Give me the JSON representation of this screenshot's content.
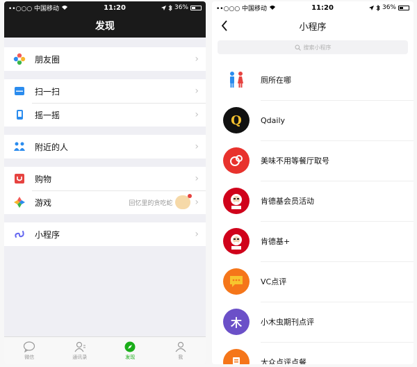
{
  "left": {
    "status": {
      "carrier": "••○○○ 中国移动",
      "time": "11:20",
      "battery": "36%"
    },
    "title": "发现",
    "groups": [
      [
        {
          "label": "朋友圈",
          "icon": "moments-icon"
        }
      ],
      [
        {
          "label": "扫一扫",
          "icon": "scan-icon"
        },
        {
          "label": "摇一摇",
          "icon": "shake-icon"
        }
      ],
      [
        {
          "label": "附近的人",
          "icon": "people-nearby-icon"
        }
      ],
      [
        {
          "label": "购物",
          "icon": "shopping-icon"
        },
        {
          "label": "游戏",
          "icon": "games-icon",
          "extra": "回忆里的贪吃蛇"
        }
      ],
      [
        {
          "label": "小程序",
          "icon": "mini-program-icon"
        }
      ]
    ],
    "tabs": [
      {
        "label": "微信",
        "icon": "chats-icon",
        "active": false
      },
      {
        "label": "通讯录",
        "icon": "contacts-icon",
        "active": false
      },
      {
        "label": "发现",
        "icon": "discover-icon",
        "active": true
      },
      {
        "label": "我",
        "icon": "me-icon",
        "active": false
      }
    ],
    "colors": {
      "nav_bg": "#1a1a1a",
      "active_tab": "#1aad19"
    }
  },
  "right": {
    "status": {
      "carrier": "••○○○ 中国移动",
      "time": "11:20",
      "battery": "36%"
    },
    "title": "小程序",
    "search_placeholder": "搜索小程序",
    "items": [
      {
        "name": "厕所在哪",
        "logo": "toilet-logo"
      },
      {
        "name": "Qdaily",
        "logo": "qdaily-logo",
        "logo_text": "Q"
      },
      {
        "name": "美味不用等餐厅取号",
        "logo": "meiwei-logo"
      },
      {
        "name": "肯德基会员活动",
        "logo": "kfc-logo"
      },
      {
        "name": "肯德基+",
        "logo": "kfc-logo"
      },
      {
        "name": "VC点评",
        "logo": "vc-logo"
      },
      {
        "name": "小木虫期刊点评",
        "logo": "xiaomuchong-logo",
        "logo_text": "木"
      },
      {
        "name": "大众点评点餐",
        "logo": "dianping-logo"
      }
    ]
  }
}
